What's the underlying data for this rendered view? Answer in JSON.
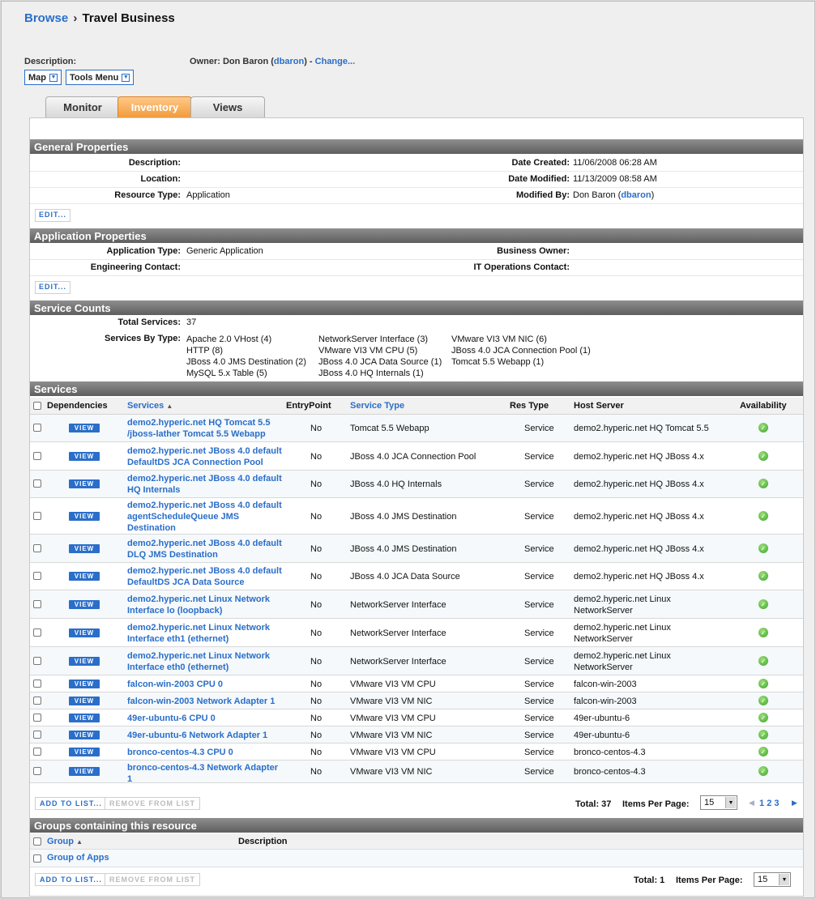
{
  "breadcrumb": {
    "root": "Browse",
    "sep": "›",
    "current": "Travel Business"
  },
  "header": {
    "description_label": "Description:",
    "owner_label": "Owner:",
    "owner_name": "Don Baron (",
    "owner_user": "dbaron",
    "owner_close": ") -",
    "change": "Change..."
  },
  "toolbar": {
    "map": "Map",
    "tools": "Tools Menu"
  },
  "tabs": [
    "Monitor",
    "Inventory",
    "Views"
  ],
  "general": {
    "title": "General Properties",
    "description_label": "Description:",
    "location_label": "Location:",
    "resource_type_label": "Resource Type:",
    "resource_type": "Application",
    "date_created_label": "Date Created:",
    "date_created": "11/06/2008 06:28 AM",
    "date_modified_label": "Date Modified:",
    "date_modified": "11/13/2009 08:58 AM",
    "modified_by_label": "Modified By:",
    "modified_by": "Don Baron (",
    "modified_by_user": "dbaron",
    "modified_by_close": ")",
    "edit": "EDIT..."
  },
  "application": {
    "title": "Application Properties",
    "app_type_label": "Application Type:",
    "app_type": "Generic Application",
    "eng_contact_label": "Engineering Contact:",
    "business_owner_label": "Business Owner:",
    "it_ops_label": "IT Operations Contact:",
    "edit": "EDIT..."
  },
  "counts": {
    "title": "Service Counts",
    "total_label": "Total Services:",
    "total": "37",
    "by_type_label": "Services By Type:",
    "col1": [
      "Apache 2.0 VHost (4)",
      "HTTP (8)",
      "JBoss 4.0 JMS Destination (2)",
      "MySQL 5.x Table (5)"
    ],
    "col2": [
      "NetworkServer Interface (3)",
      "VMware VI3 VM CPU (5)",
      "JBoss 4.0 JCA Data Source (1)",
      "JBoss 4.0 HQ Internals (1)"
    ],
    "col3": [
      "VMware VI3 VM NIC (6)",
      "JBoss 4.0 JCA Connection Pool (1)",
      "Tomcat 5.5 Webapp (1)"
    ]
  },
  "services": {
    "title": "Services",
    "headers": {
      "dependencies": "Dependencies",
      "services": "Services",
      "sort": "▲",
      "entry": "EntryPoint",
      "type": "Service Type",
      "res": "Res Type",
      "host": "Host Server",
      "avail": "Availability"
    },
    "view_label": "VIEW",
    "rows": [
      {
        "name": "demo2.hyperic.net HQ Tomcat 5.5 /jboss-lather Tomcat 5.5 Webapp",
        "entry": "No",
        "type": "Tomcat 5.5 Webapp",
        "res": "Service",
        "host": "demo2.hyperic.net HQ Tomcat 5.5"
      },
      {
        "name": "demo2.hyperic.net JBoss 4.0 default DefaultDS JCA Connection Pool",
        "entry": "No",
        "type": "JBoss 4.0 JCA Connection Pool",
        "res": "Service",
        "host": "demo2.hyperic.net HQ JBoss 4.x"
      },
      {
        "name": "demo2.hyperic.net JBoss 4.0 default HQ Internals",
        "entry": "No",
        "type": "JBoss 4.0 HQ Internals",
        "res": "Service",
        "host": "demo2.hyperic.net HQ JBoss 4.x"
      },
      {
        "name": "demo2.hyperic.net JBoss 4.0 default agentScheduleQueue JMS Destination",
        "entry": "No",
        "type": "JBoss 4.0 JMS Destination",
        "res": "Service",
        "host": "demo2.hyperic.net HQ JBoss 4.x"
      },
      {
        "name": "demo2.hyperic.net JBoss 4.0 default DLQ JMS Destination",
        "entry": "No",
        "type": "JBoss 4.0 JMS Destination",
        "res": "Service",
        "host": "demo2.hyperic.net HQ JBoss 4.x"
      },
      {
        "name": "demo2.hyperic.net JBoss 4.0 default DefaultDS JCA Data Source",
        "entry": "No",
        "type": "JBoss 4.0 JCA Data Source",
        "res": "Service",
        "host": "demo2.hyperic.net HQ JBoss 4.x"
      },
      {
        "name": "demo2.hyperic.net Linux Network Interface lo (loopback)",
        "entry": "No",
        "type": "NetworkServer Interface",
        "res": "Service",
        "host": "demo2.hyperic.net Linux NetworkServer"
      },
      {
        "name": "demo2.hyperic.net Linux Network Interface eth1 (ethernet)",
        "entry": "No",
        "type": "NetworkServer Interface",
        "res": "Service",
        "host": "demo2.hyperic.net Linux NetworkServer"
      },
      {
        "name": "demo2.hyperic.net Linux Network Interface eth0 (ethernet)",
        "entry": "No",
        "type": "NetworkServer Interface",
        "res": "Service",
        "host": "demo2.hyperic.net Linux NetworkServer"
      },
      {
        "name": "falcon-win-2003 CPU 0",
        "entry": "No",
        "type": "VMware VI3 VM CPU",
        "res": "Service",
        "host": "falcon-win-2003"
      },
      {
        "name": "falcon-win-2003 Network Adapter 1",
        "entry": "No",
        "type": "VMware VI3 VM NIC",
        "res": "Service",
        "host": "falcon-win-2003"
      },
      {
        "name": "49er-ubuntu-6 CPU 0",
        "entry": "No",
        "type": "VMware VI3 VM CPU",
        "res": "Service",
        "host": "49er-ubuntu-6"
      },
      {
        "name": "49er-ubuntu-6 Network Adapter 1",
        "entry": "No",
        "type": "VMware VI3 VM NIC",
        "res": "Service",
        "host": "49er-ubuntu-6"
      },
      {
        "name": "bronco-centos-4.3 CPU 0",
        "entry": "No",
        "type": "VMware VI3 VM CPU",
        "res": "Service",
        "host": "bronco-centos-4.3"
      },
      {
        "name": "bronco-centos-4.3 Network Adapter 1",
        "entry": "No",
        "type": "VMware VI3 VM NIC",
        "res": "Service",
        "host": "bronco-centos-4.3"
      }
    ],
    "add": "ADD TO LIST...",
    "remove": "REMOVE FROM LIST",
    "total_label": "Total: 37",
    "per_page_label": "Items Per Page:",
    "per_page": "15",
    "pages": [
      "1",
      "2",
      "3"
    ]
  },
  "groups": {
    "title": "Groups containing this resource",
    "col_group": "Group",
    "sort": "▲",
    "col_desc": "Description",
    "rows": [
      "Group of Apps"
    ],
    "add": "ADD TO LIST...",
    "remove": "REMOVE FROM LIST",
    "total_label": "Total: 1",
    "per_page_label": "Items Per Page:",
    "per_page": "15"
  }
}
